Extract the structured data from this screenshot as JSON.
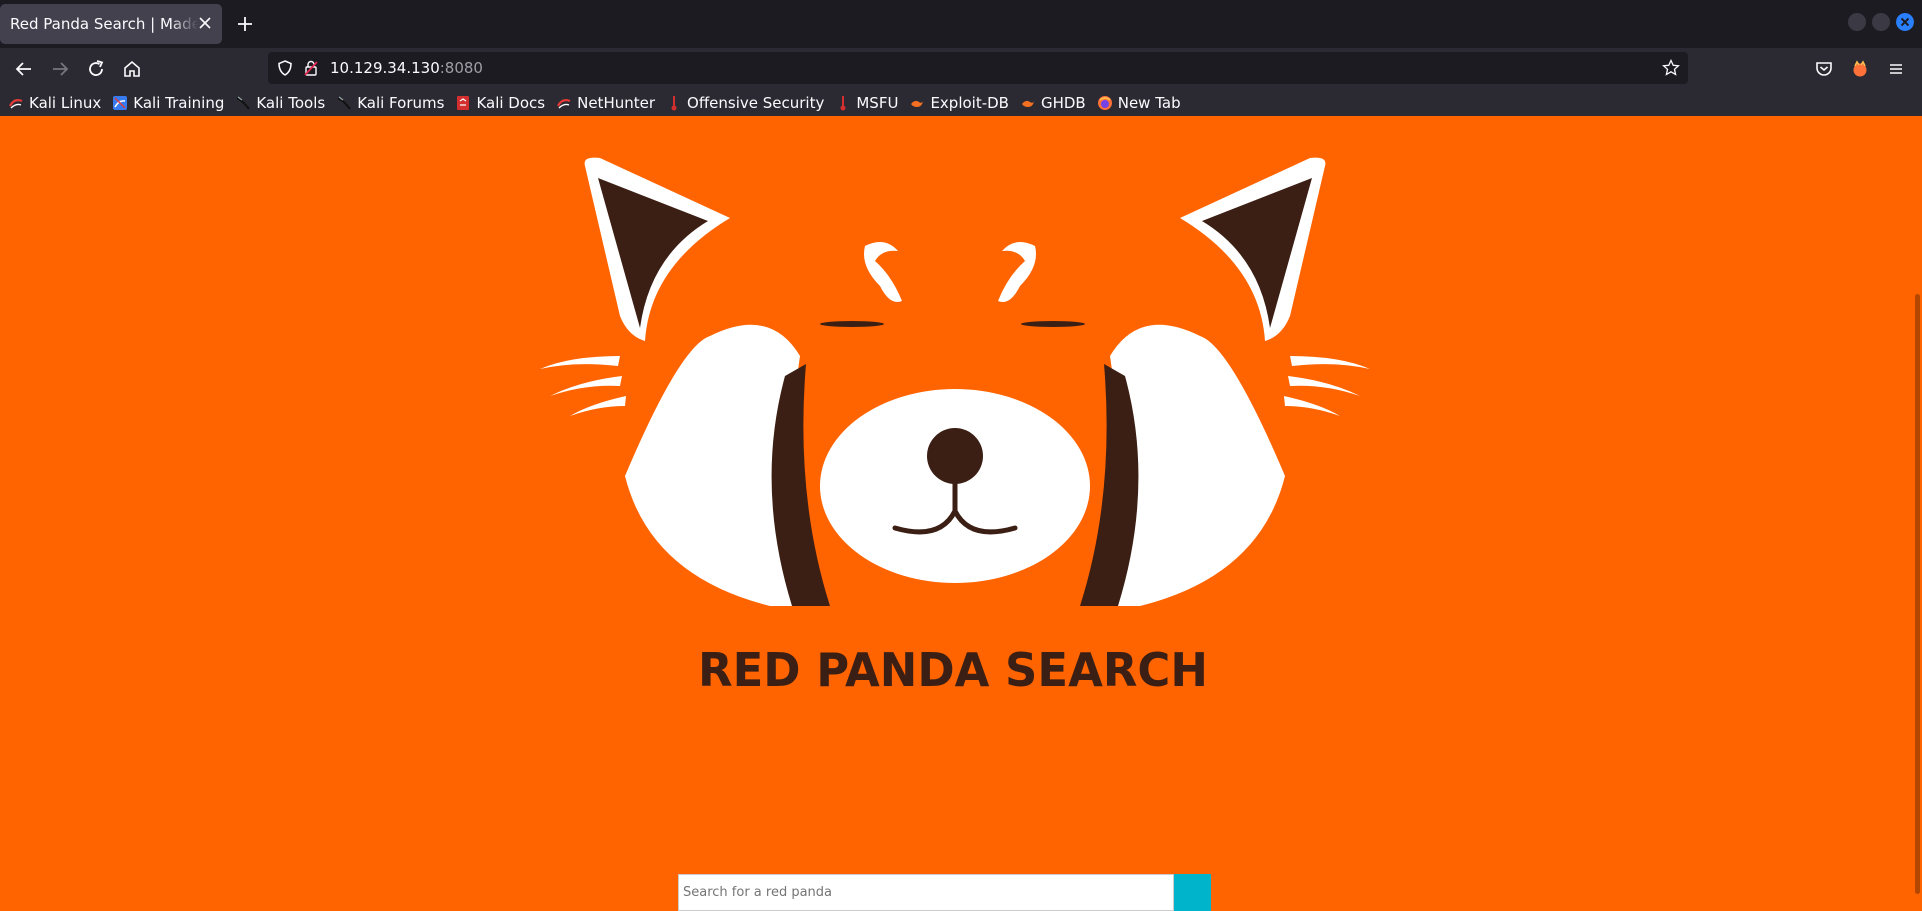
{
  "browser": {
    "tab_title": "Red Panda Search | Made with Spring Boot",
    "url_host": "10.129.34.130",
    "url_port": ":8080"
  },
  "bookmarks": [
    {
      "label": "Kali Linux",
      "icon": "kali-dragon-icon"
    },
    {
      "label": "Kali Training",
      "icon": "kali-training-icon"
    },
    {
      "label": "Kali Tools",
      "icon": "kali-tools-icon"
    },
    {
      "label": "Kali Forums",
      "icon": "kali-forums-icon"
    },
    {
      "label": "Kali Docs",
      "icon": "kali-docs-icon"
    },
    {
      "label": "NetHunter",
      "icon": "nethunter-icon"
    },
    {
      "label": "Offensive Security",
      "icon": "offsec-icon"
    },
    {
      "label": "MSFU",
      "icon": "msfu-icon"
    },
    {
      "label": "Exploit-DB",
      "icon": "exploit-db-icon"
    },
    {
      "label": "GHDB",
      "icon": "ghdb-icon"
    },
    {
      "label": "New Tab",
      "icon": "firefox-icon"
    }
  ],
  "page": {
    "logo_title": "RED PANDA SEARCH",
    "search_placeholder": "Search for a red panda",
    "search_value": ""
  },
  "colors": {
    "page_background": "#ff6400",
    "panda_dark": "#3c1f14",
    "search_button": "#00b4cc"
  }
}
